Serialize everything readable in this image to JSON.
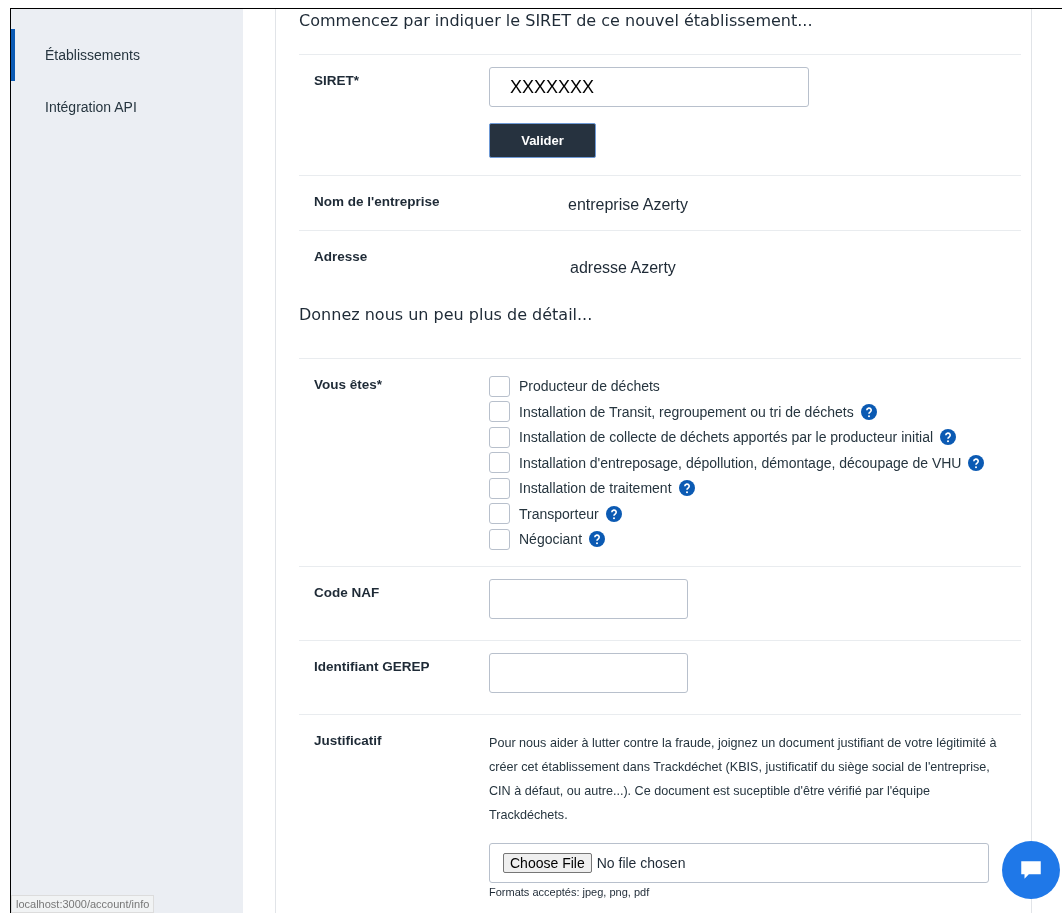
{
  "sidebar": {
    "items": [
      {
        "label": "Établissements",
        "selected": true
      },
      {
        "label": "Intégration API",
        "selected": false
      }
    ]
  },
  "section_1": {
    "heading": "Commencez par indiquer le SIRET de ce nouvel établissement...",
    "siret": {
      "label": "SIRET*",
      "value": "XXXXXXX",
      "button": "Valider"
    },
    "company_name": {
      "label": "Nom de l'entreprise",
      "value": "entreprise Azerty"
    },
    "address": {
      "label": "Adresse",
      "value": "adresse Azerty"
    }
  },
  "section_2": {
    "heading": "Donnez nous un peu plus de détail...",
    "roles": {
      "label": "Vous êtes*",
      "options": [
        {
          "label": "Producteur de déchets",
          "checked": false,
          "help": false
        },
        {
          "label": "Installation de Transit, regroupement ou tri de déchets",
          "checked": false,
          "help": true
        },
        {
          "label": "Installation de collecte de déchets apportés par le producteur initial",
          "checked": false,
          "help": true
        },
        {
          "label": "Installation d'entreposage, dépollution, démontage, découpage de VHU",
          "checked": false,
          "help": true
        },
        {
          "label": "Installation de traitement",
          "checked": false,
          "help": true
        },
        {
          "label": "Transporteur",
          "checked": false,
          "help": true
        },
        {
          "label": "Négociant",
          "checked": false,
          "help": true
        }
      ]
    },
    "naf": {
      "label": "Code NAF"
    },
    "gerep": {
      "label": "Identifiant GEREP"
    },
    "proof": {
      "label": "Justificatif",
      "description": "Pour nous aider à lutter contre la fraude, joignez un document justifiant de votre légitimité à créer cet établissement dans Trackdéchet (KBIS, justificatif du siège social de l'entreprise, CIN à défaut, ou autre...). Ce document est suceptible d'être vérifié par l'équipe Trackdéchets.",
      "file_button": "Choose File",
      "file_status": "No file chosen",
      "formats": "Formats acceptés: jpeg, png, pdf"
    }
  },
  "status_bar": {
    "url": "localhost:3000/account/info"
  }
}
